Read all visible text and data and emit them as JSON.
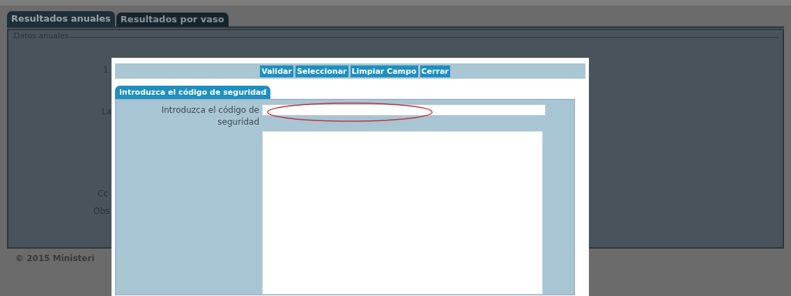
{
  "tabs": [
    {
      "label": "Resultados anuales",
      "selected": true
    },
    {
      "label": "Resultados por vaso",
      "selected": false
    }
  ],
  "fieldset": {
    "legend": "Datos anuales",
    "label_fragments": [
      "1",
      "La",
      "Cc",
      "Obs"
    ]
  },
  "footer": "© 2015 Ministeri",
  "dialog": {
    "buttons": [
      "Validar",
      "Seleccionar",
      "Limpiar Campo",
      "Cerrar"
    ],
    "tab": "Introduzca el código de seguridad",
    "field_label": "Introduzca el código de seguridad",
    "highlighted": true
  }
}
